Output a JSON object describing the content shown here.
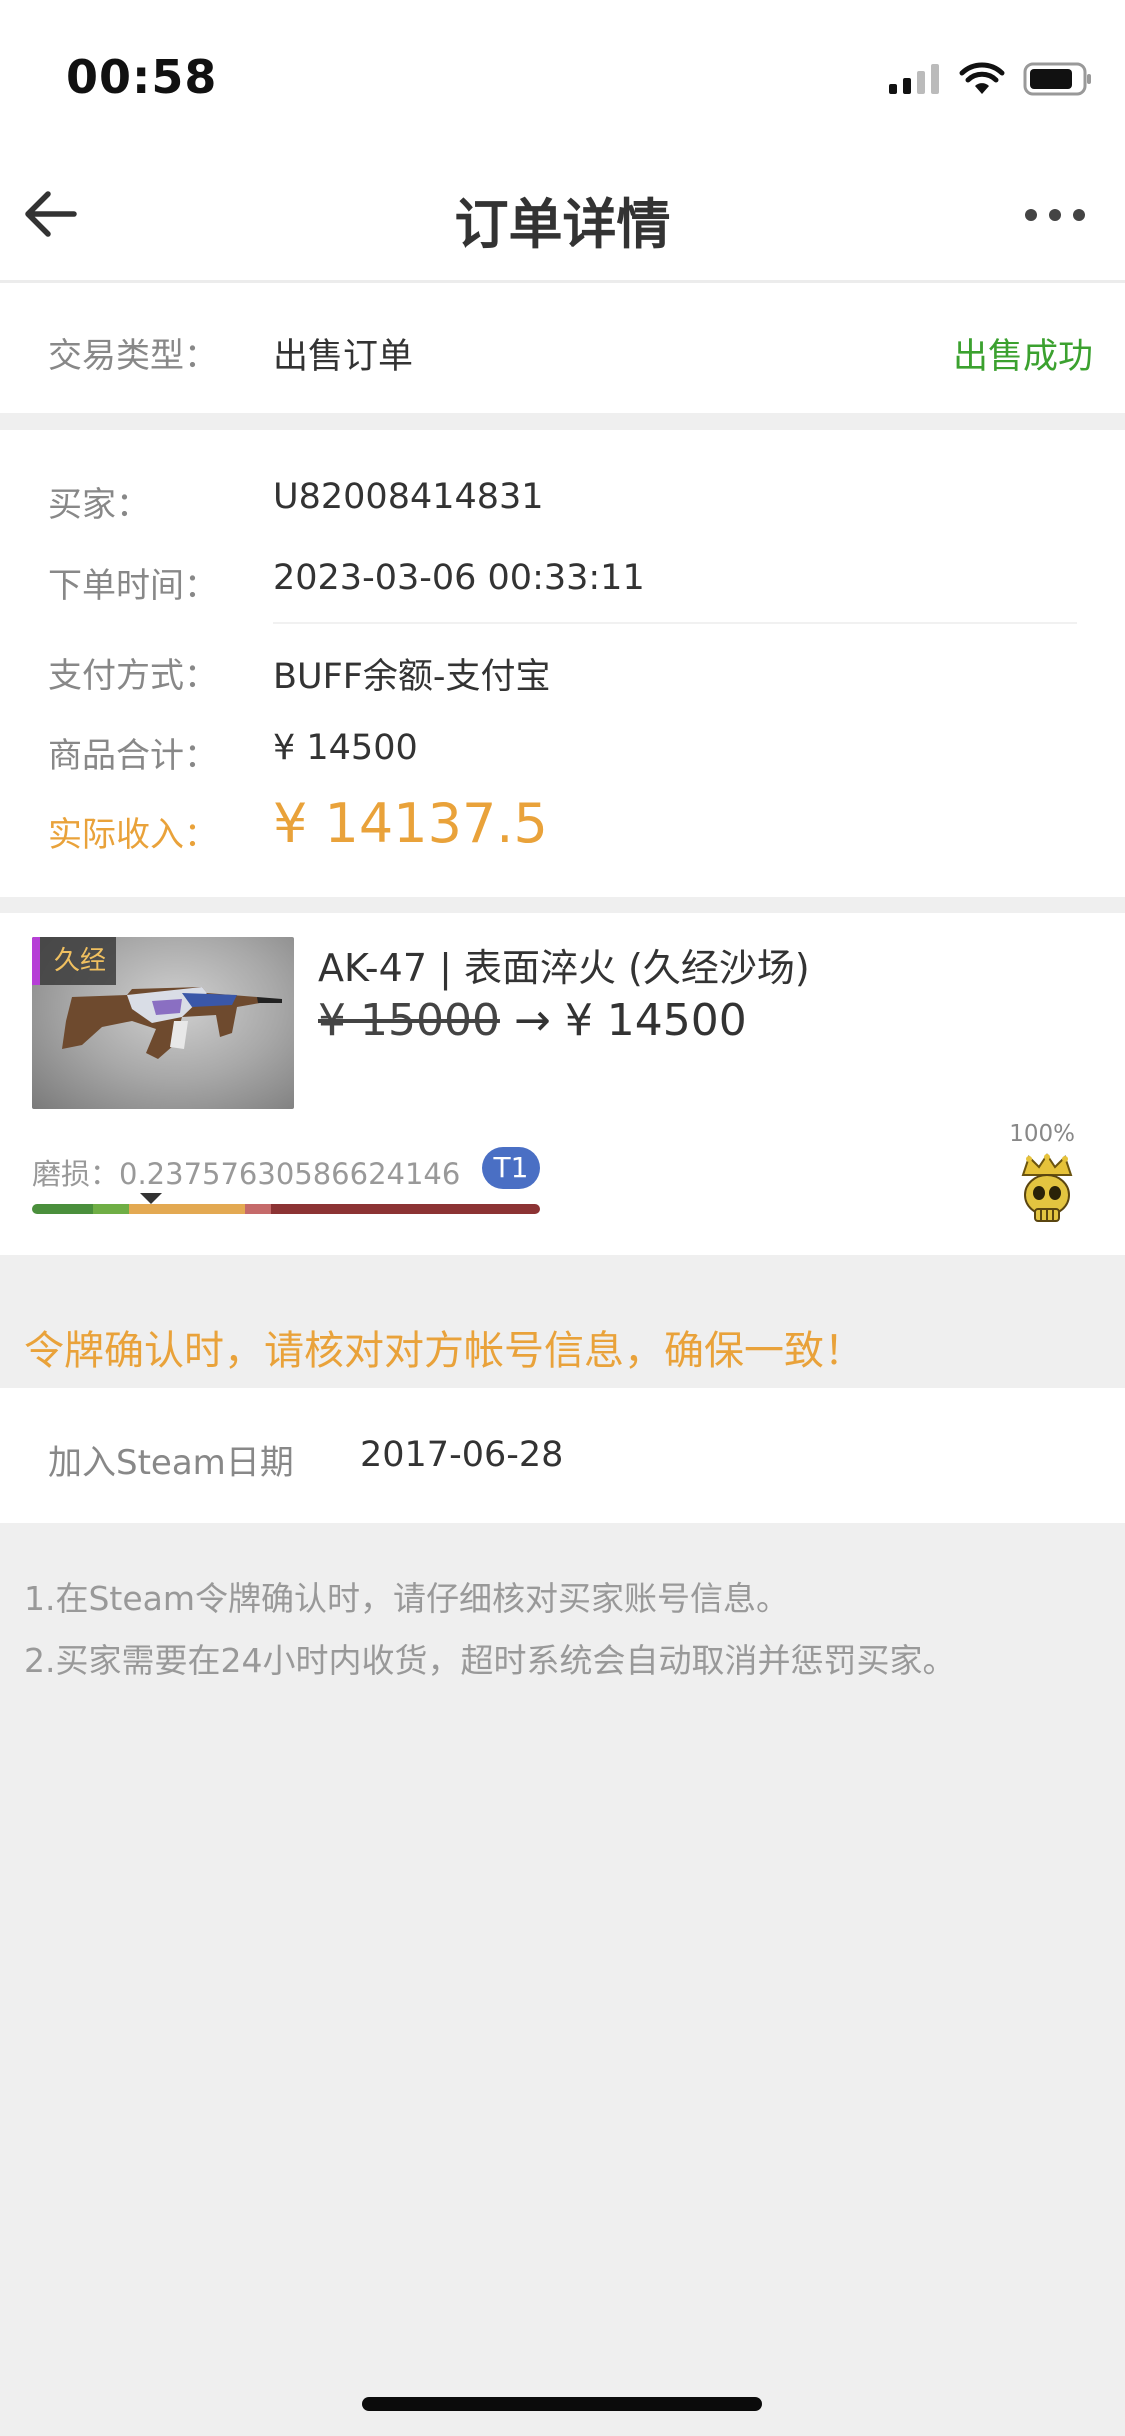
{
  "status_bar": {
    "time": "00:58"
  },
  "nav": {
    "title": "订单详情",
    "back_icon": "arrow-left-icon",
    "more_icon": "more-horizontal-icon"
  },
  "order_type": {
    "label": "交易类型：",
    "value": "出售订单",
    "status": "出售成功",
    "status_color": "#3ba12f"
  },
  "order_info": {
    "buyer_label": "买家：",
    "buyer_value": "U82008414831",
    "time_label": "下单时间：",
    "time_value": "2023-03-06 00:33:11",
    "payment_label": "支付方式：",
    "payment_value": "BUFF余额-支付宝",
    "total_label": "商品合计：",
    "total_value": "¥ 14500",
    "income_label": "实际收入：",
    "income_value": "¥ 14137.5",
    "income_color": "#e9a23a"
  },
  "item": {
    "tag": "久经",
    "name": "AK-47 | 表面淬火 (久经沙场)",
    "old_price": "¥ 15000",
    "arrow": "→",
    "new_price": "¥ 14500",
    "wear_text": "磨损：0.23757630586624146",
    "tier": "T1",
    "percent": "100%",
    "wear_segments": [
      "#4a8f3c",
      "#6fae45",
      "#e3a952",
      "#c56a6a",
      "#8c3334"
    ]
  },
  "warning": "令牌确认时，请核对对方帐号信息，确保一致！",
  "steam": {
    "label": "加入Steam日期",
    "value": "2017-06-28"
  },
  "notes": [
    "1.在Steam令牌确认时，请仔细核对买家账号信息。",
    "2.买家需要在24小时内收货，超时系统会自动取消并惩罚买家。"
  ]
}
